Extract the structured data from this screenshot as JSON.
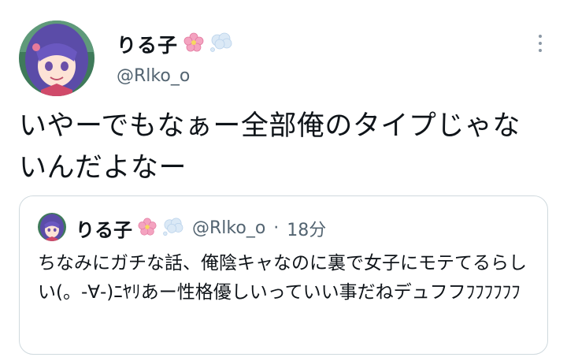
{
  "author": {
    "display_name": "りる子",
    "handle": "@Rlko_o",
    "name_emoji": [
      "cherry-blossom-icon",
      "thought-balloon-icon"
    ]
  },
  "tweet": {
    "text": "いやーでもなぁー全部俺のタイプじゃないんだよなー"
  },
  "quote": {
    "display_name": "りる子",
    "handle": "@Rlko_o",
    "separator": "·",
    "time": "18分",
    "text": "ちなみにガチな話、俺陰キャなのに裏で女子にモテてるらしい(。-∀-)ﾆﾔﾘあー性格優しいっていい事だねデュフフﾌﾌﾌﾌﾌﾌ"
  },
  "colors": {
    "text": "#0f1419",
    "secondary": "#536471",
    "border": "#cfd9de",
    "avatar_hair": "#5b4ca8",
    "avatar_bg": "#3f7a5a"
  }
}
